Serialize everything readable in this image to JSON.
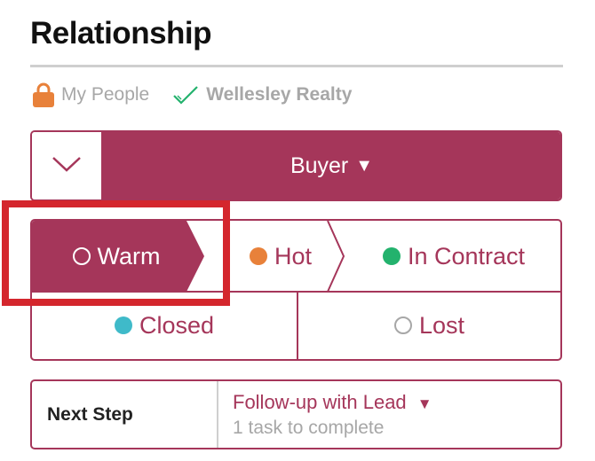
{
  "header": {
    "title": "Relationship"
  },
  "tags": {
    "my_people": "My People",
    "brokerage": "Wellesley Realty"
  },
  "relationship_type": {
    "selected": "Buyer",
    "dropdown_symbol": "▼"
  },
  "stages": [
    {
      "label": "Warm",
      "dot_color": "#ffffff",
      "selected": true
    },
    {
      "label": "Hot",
      "dot_color": "#e8813a",
      "selected": false
    },
    {
      "label": "In Contract",
      "dot_color": "#23b26d",
      "selected": false
    },
    {
      "label": "Closed",
      "dot_color": "#3fbac9",
      "selected": false
    },
    {
      "label": "Lost",
      "dot_color": "#ffffff",
      "selected": false
    }
  ],
  "next_step": {
    "label": "Next Step",
    "task": "Follow-up with Lead",
    "dropdown_symbol": "▼",
    "subtitle": "1 task to complete"
  },
  "colors": {
    "accent": "#a5365a",
    "highlight": "#d4262d",
    "muted_text": "#a7a7a7",
    "lock": "#e8813a",
    "check": "#23b26d"
  },
  "icons": {
    "lock": "lock-icon",
    "check": "checkmark-icon",
    "toggle": "chevron-down-icon"
  }
}
